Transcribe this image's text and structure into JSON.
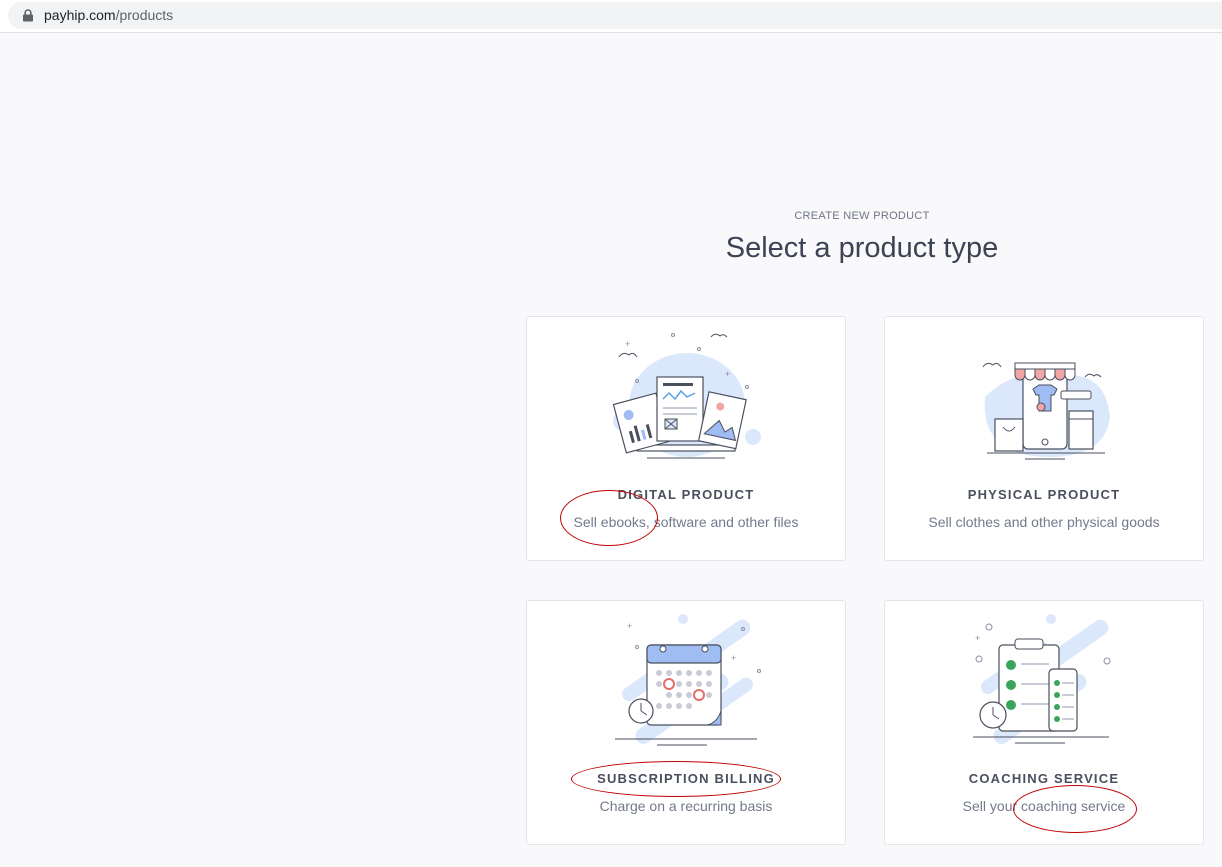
{
  "browser": {
    "url_host": "payhip.com",
    "url_path": "/products"
  },
  "header": {
    "kicker": "CREATE NEW PRODUCT",
    "title": "Select a product type"
  },
  "products": [
    {
      "name": "DIGITAL PRODUCT",
      "description": "Sell ebooks, software and other files",
      "icon": "digital-files-illustration"
    },
    {
      "name": "PHYSICAL PRODUCT",
      "description": "Sell clothes and other physical goods",
      "icon": "storefront-illustration"
    },
    {
      "name": "SUBSCRIPTION BILLING",
      "description": "Charge on a recurring basis",
      "icon": "calendar-illustration"
    },
    {
      "name": "COACHING SERVICE",
      "description": "Sell your coaching service",
      "icon": "checklist-illustration"
    }
  ],
  "colors": {
    "accent_blue": "#dbe7fb",
    "line": "#4a4f5e",
    "highlight_red": "#e86b6b",
    "annotation_red": "#c00000",
    "check_green": "#3aa45a"
  }
}
